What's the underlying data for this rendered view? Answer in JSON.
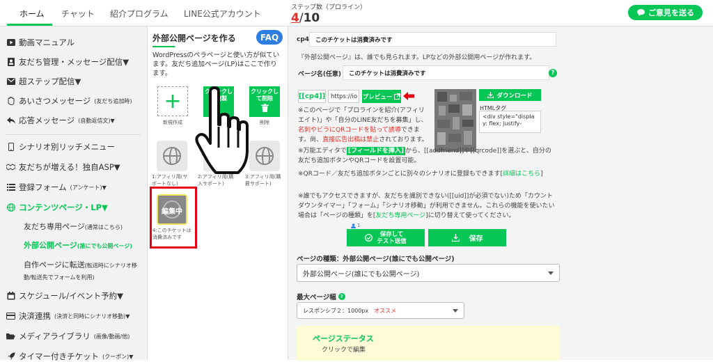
{
  "nav": {
    "tabs": [
      "ホーム",
      "チャット",
      "紹介プログラム",
      "LINE公式アカウント"
    ]
  },
  "steps": {
    "label": "ステップ数（プロライン）",
    "current": "4",
    "sep": "/",
    "total": "10"
  },
  "feedback": {
    "label": "ご意見を送る"
  },
  "sidebar": {
    "items": [
      {
        "label": "動画マニュアル",
        "suffix": ""
      },
      {
        "label": "友だち管理・メッセージ配信▼",
        "suffix": ""
      },
      {
        "label": "超ステップ配信▼",
        "suffix": ""
      },
      {
        "label": "あいさつメッセージ",
        "suffix": "(友だち追加時)"
      },
      {
        "label": "応答メッセージ",
        "suffix": "(自動返信文)▼"
      },
      {
        "label": "シナリオ別リッチメニュー",
        "suffix": ""
      },
      {
        "label": "友だちが増える！独自ASP▼",
        "suffix": ""
      },
      {
        "label": "登録フォーム",
        "suffix": "(アンケート)▼"
      },
      {
        "label": "コンテンツページ・LP▼",
        "suffix": ""
      },
      {
        "label": "スケジュール/イベント予約▼",
        "suffix": ""
      },
      {
        "label": "決済連携",
        "suffix": "(決済と同時にシナリオ移動)▼"
      },
      {
        "label": "メディアライブラリ",
        "suffix": "(画像/動画/他)"
      },
      {
        "label": "タイマー付きチケット",
        "suffix": "(クーポン)▼"
      }
    ],
    "sub": [
      {
        "label": "友だち専用ページ",
        "suffix": "(通常はこちら)"
      },
      {
        "label": "外部公開ページ",
        "suffix": "(誰にでも公開ページ)"
      },
      {
        "label": "自作ページに転送",
        "suffix": "(転送時にシナリオ移動/転送先でフォームを利用)"
      }
    ]
  },
  "middle": {
    "title": "外部公開ページを作る",
    "faq": "FAQ",
    "desc": "WordPressのペラページと使い方が似ています。友だち追加ページ(LP)はここで作ります。",
    "new_caption": "新規作成",
    "copy_btn": "クリックして複製",
    "delete_btn": "クリックして削除",
    "delete_caption": "削除",
    "tiles": [
      "1:アフィリ用(サポートなし)",
      "2:アフィリ用(購入サポート)",
      "3:アフィリ用(購薮サポート)"
    ],
    "editing": "編集中",
    "ticket_caption": "4:このチケットは消費済みです"
  },
  "main": {
    "cp_label": "cp4:",
    "cp_value": "このチケットは消費済みです",
    "intro": "『外部公開ページ』は、誰でも見られます。LPなどの外部公開用ページが作れます。",
    "name_label": "ページ名(任意)",
    "name_value": "このチケットは消費済みです",
    "tag": "[[cp4]]",
    "url": "https://io",
    "preview": "プレビュー",
    "download": "ダウンロード",
    "html_tag_label": "HTMLタグ",
    "html_code": "<div style=\"display: flex; justify-",
    "note1_a": "※このページで「プロラインを紹介(アフィリエイト)」や「自分のLINE友だちを募集」し、",
    "note1_red1": "名刺やビラにQRコードを貼って誘導",
    "note1_b": "できます。尚、",
    "note1_red2": "直接広告出稿は禁止",
    "note1_c": "されております。",
    "note2_a": "※万能エディタで",
    "note2_btn": "[フィールドを挿入]",
    "note2_b": "から、[[addfriend]]や[[qrcode]]を選ぶと、自分の友だち追加ボタンやQRコードを設置可能。",
    "note3_a": "※QRコード／友だち追加ボタンごとに別々のシナリオに登録もできます[",
    "note3_link": "詳細はこちら",
    "note3_b": "]",
    "note4_a": "※誰でもアクセスできますが、友だちを識別できない([[uid]]が必須でない)ため「カウントダウンタイマー」「フォーム」「シナリオ移動」が利用できません。これらの機能を使いたい場合は「ページの種類」を[",
    "note4_link": "友だち専用ページ",
    "note4_b": "]に切り替えて使ってください。",
    "counter": "1",
    "save_test": "保存して\nテスト送信",
    "save": "保存",
    "type_label": "ページの種類：外部公開ページ(誰にでも公開ページ)",
    "type_value": "外部公開ページ(誰にでも公開ページ)",
    "width_label": "最大ページ幅",
    "width_value": "レスポンシブ２：1000px",
    "width_reco": "オススメ",
    "status_title": "ページステータス",
    "status_sub": "クリックで編集"
  },
  "colors": {
    "accent": "#06c755",
    "faq": "#2e7de0",
    "alert": "#e0322b"
  }
}
